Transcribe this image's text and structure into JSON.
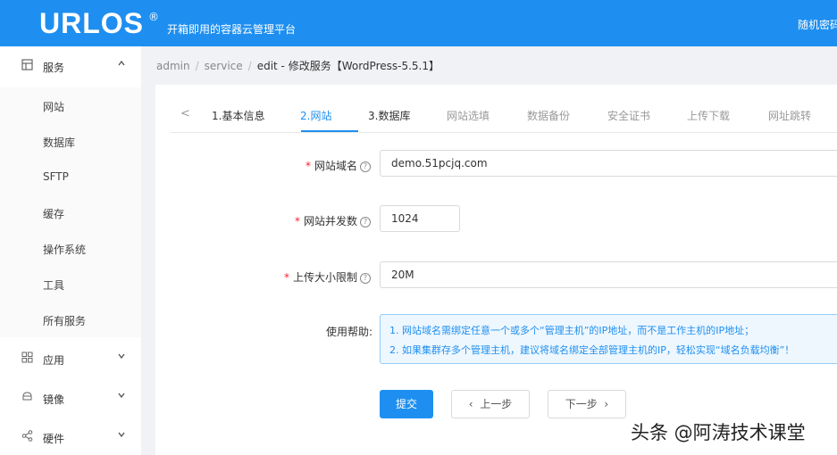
{
  "header": {
    "logo": "URLOS",
    "logo_mark": "®",
    "slogan": "开箱即用的容器云管理平台",
    "right_text": "随机密码"
  },
  "sidebar": {
    "groups": [
      {
        "label": "服务",
        "icon": "grid-icon",
        "chevron": "up"
      },
      {
        "label": "应用",
        "icon": "apps-icon",
        "chevron": "down"
      },
      {
        "label": "镜像",
        "icon": "cube-icon",
        "chevron": "down"
      },
      {
        "label": "硬件",
        "icon": "share-icon",
        "chevron": "down"
      }
    ],
    "sub_items": [
      "网站",
      "数据库",
      "SFTP",
      "缓存",
      "操作系统",
      "工具",
      "所有服务"
    ]
  },
  "breadcrumb": {
    "items": [
      "admin",
      "service",
      "edit"
    ],
    "current": "修改服务【WordPress-5.5.1】"
  },
  "tabs": {
    "prev_arrow": "<",
    "items": [
      "1.基本信息",
      "2.网站",
      "3.数据库",
      "网站选填",
      "数据备份",
      "安全证书",
      "上传下载",
      "网址跳转"
    ],
    "active_index": 1
  },
  "form": {
    "domain": {
      "label": "网站域名",
      "value": "demo.51pcjq.com"
    },
    "concurrency": {
      "label": "网站并发数",
      "value": "1024"
    },
    "upload_limit": {
      "label": "上传大小限制",
      "value": "20M"
    },
    "help": {
      "label": "使用帮助:",
      "lines": [
        "1. 网站域名需绑定任意一个或多个“管理主机”的IP地址，而不是工作主机的IP地址；",
        "2. 如果集群存多个管理主机，建议将域名绑定全部管理主机的IP，轻松实现“域名负载均衡”！"
      ]
    }
  },
  "buttons": {
    "submit": "提交",
    "prev": "上一步",
    "next": "下一步"
  },
  "watermark": "头条 @阿涛技术课堂",
  "colors": {
    "primary": "#1e8ff0",
    "required": "#f5222d"
  }
}
